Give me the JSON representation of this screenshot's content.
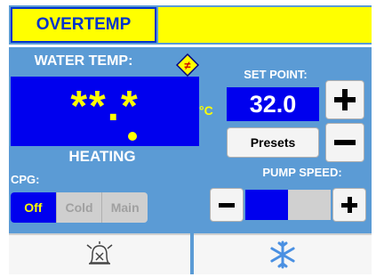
{
  "alarm": {
    "label": "OVERTEMP",
    "color": "#ffff00"
  },
  "water_temp": {
    "label": "WATER TEMP:",
    "value": "**.*",
    "unit": "°C"
  },
  "status": "HEATING",
  "set_point": {
    "label": "SET POINT:",
    "value": "32.0"
  },
  "presets_label": "Presets",
  "cpg": {
    "label": "CPG:",
    "options": [
      "Off",
      "Cold",
      "Main"
    ],
    "selected": "Off"
  },
  "pump_speed": {
    "label": "PUMP SPEED:",
    "level": 0.5
  },
  "icons": {
    "hint": "hint-icon",
    "alarm_silence": "alarm-silence-icon",
    "cool": "snowflake-icon"
  },
  "colors": {
    "panel": "#5b9bd5",
    "display": "#0000ee",
    "highlight": "#ffff00"
  }
}
